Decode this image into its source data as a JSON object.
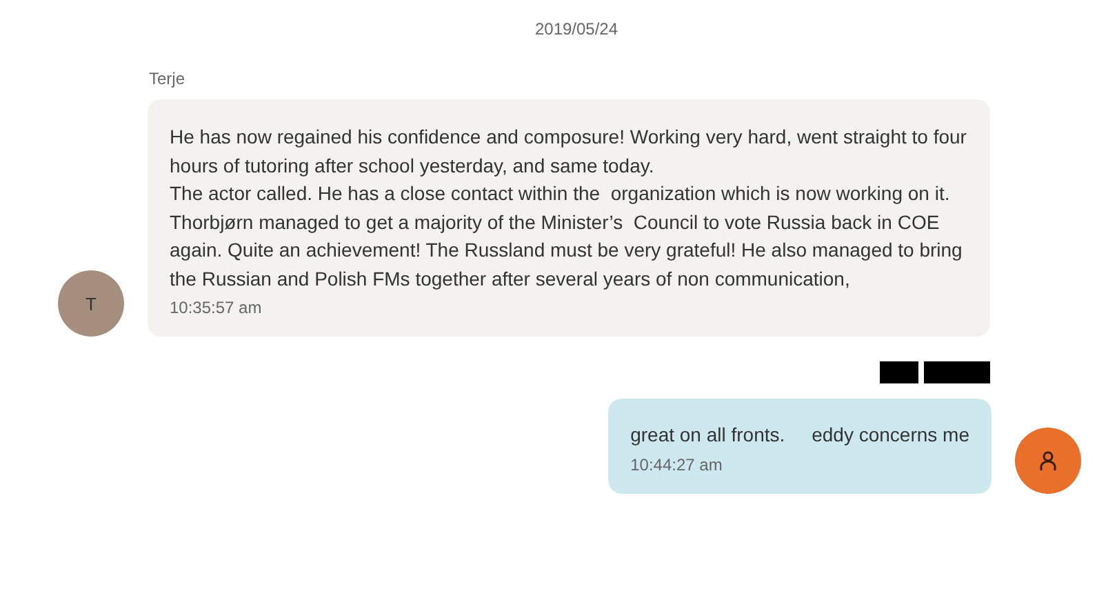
{
  "date": "2019/05/24",
  "messages": [
    {
      "kind": "incoming",
      "sender": "Terje",
      "avatar": {
        "kind": "initial",
        "text": "T"
      },
      "text": "He has now regained his confidence and composure! Working very hard, went straight to four hours of tutoring after school yesterday, and same today.\nThe actor called. He has a close contact within the  organization which is now working on it.\nThorbjørn managed to get a majority of the Minister’s  Council to vote Russia back in COE again. Quite an achievement! The Russland must be very grateful! He also managed to bring the Russian and Polish FMs together after several years of non communication,",
      "time": "10:35:57 am"
    },
    {
      "kind": "outgoing",
      "redactions": [
        {
          "kind": "block"
        },
        {
          "kind": "block"
        }
      ],
      "avatar": {
        "kind": "person"
      },
      "text": "great on all fronts.     eddy concerns me",
      "time": "10:44:27 am"
    }
  ]
}
